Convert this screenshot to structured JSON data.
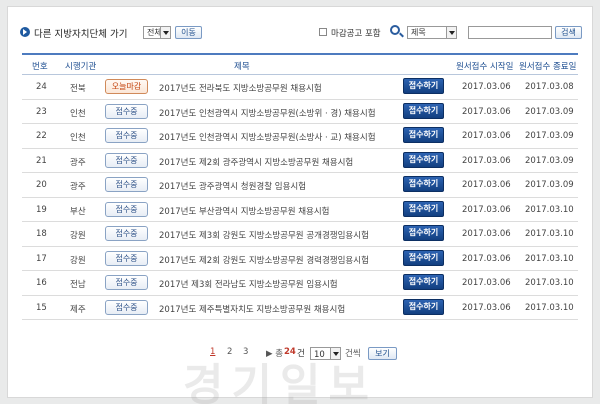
{
  "topbar": {
    "nav_label": "다른 지방자치단체 가기",
    "region_select": "전체",
    "go_button": "이동",
    "closed_label": "마감공고 포함",
    "search_field_select": "제목",
    "search_value": "",
    "search_button": "검색"
  },
  "table": {
    "headers": {
      "num": "번호",
      "agency": "시행기관",
      "title": "제목",
      "start": "원서접수 시작일",
      "end": "원서접수 종료일"
    },
    "rows": [
      {
        "num": "24",
        "agency": "전북",
        "status": "오늘마감",
        "title": "2017년도 전라북도 지방소방공무원 채용시험",
        "apply": "접수하기",
        "start": "2017.03.06",
        "end": "2017.03.08"
      },
      {
        "num": "23",
        "agency": "인천",
        "status": "접수중",
        "title": "2017년도 인천광역시 지방소방공무원(소방위 · 경) 채용시험",
        "apply": "접수하기",
        "start": "2017.03.06",
        "end": "2017.03.09"
      },
      {
        "num": "22",
        "agency": "인천",
        "status": "접수중",
        "title": "2017년도 인천광역시 지방소방공무원(소방사 · 교) 채용시험",
        "apply": "접수하기",
        "start": "2017.03.06",
        "end": "2017.03.09"
      },
      {
        "num": "21",
        "agency": "광주",
        "status": "접수중",
        "title": "2017년도 제2회 광주광역시 지방소방공무원 채용시험",
        "apply": "접수하기",
        "start": "2017.03.06",
        "end": "2017.03.09"
      },
      {
        "num": "20",
        "agency": "광주",
        "status": "접수중",
        "title": "2017년도 광주광역시 청원경찰 임용시험",
        "apply": "접수하기",
        "start": "2017.03.06",
        "end": "2017.03.09"
      },
      {
        "num": "19",
        "agency": "부산",
        "status": "접수중",
        "title": "2017년도 부산광역시 지방소방공무원 채용시험",
        "apply": "접수하기",
        "start": "2017.03.06",
        "end": "2017.03.10"
      },
      {
        "num": "18",
        "agency": "강원",
        "status": "접수중",
        "title": "2017년도 제3회 강원도 지방소방공무원 공개경쟁임용시험",
        "apply": "접수하기",
        "start": "2017.03.06",
        "end": "2017.03.10"
      },
      {
        "num": "17",
        "agency": "강원",
        "status": "접수중",
        "title": "2017년도 제2회 강원도 지방소방공무원 경력경쟁임용시험",
        "apply": "접수하기",
        "start": "2017.03.06",
        "end": "2017.03.10"
      },
      {
        "num": "16",
        "agency": "전남",
        "status": "접수중",
        "title": "2017년 제3회 전라남도 지방소방공무원 임용시험",
        "apply": "접수하기",
        "start": "2017.03.06",
        "end": "2017.03.10"
      },
      {
        "num": "15",
        "agency": "제주",
        "status": "접수중",
        "title": "2017년도 제주특별자치도 지방소방공무원 채용시험",
        "apply": "접수하기",
        "start": "2017.03.06",
        "end": "2017.03.10"
      }
    ]
  },
  "pager": {
    "pages": [
      "1",
      "2",
      "3"
    ],
    "total_prefix": "▶ 총",
    "total_count": "24",
    "total_suffix": "건",
    "per_page": "10",
    "per_page_suffix": "건씩",
    "view_button": "보기"
  },
  "watermark": "경기일보",
  "colors": {
    "accent": "#1f4f91",
    "apply_button": "#1a4a8e",
    "today_status": "#c2410c"
  }
}
